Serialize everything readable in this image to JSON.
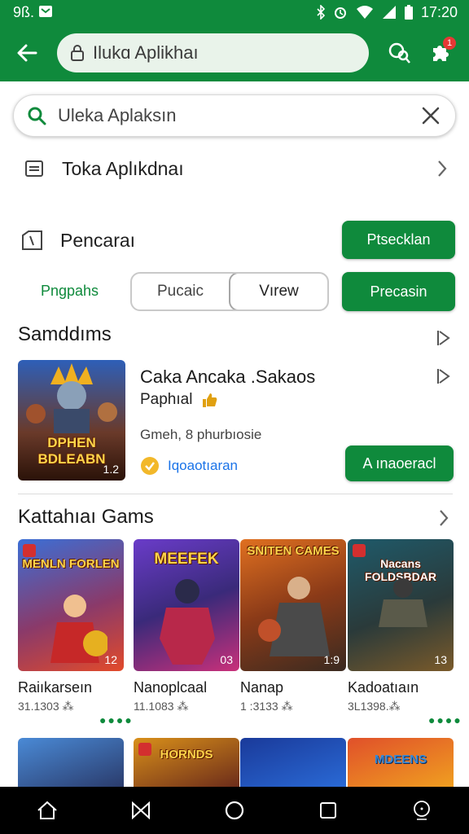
{
  "status_bar": {
    "time": "17:20",
    "left_text": "9ß."
  },
  "top_bar": {
    "url": "Ilukɑ Aplikhaı",
    "badge": "1"
  },
  "search": {
    "query": "Uleka Aplaksın"
  },
  "rows": {
    "apps_label": "Toka Aplıkdnaı",
    "search_label": "Pencaraı",
    "search_button": "Ptsecklan"
  },
  "filters": {
    "link": "Pngpahs",
    "options": [
      "Pucaic",
      "Vırew"
    ],
    "action": "Precasin"
  },
  "featured_section": {
    "title": "Samddıms",
    "game": {
      "title": "Caka Ancaka .Sakaos",
      "subtitle": "Paphıal",
      "meta": "Gmeh, 8 phurbıosie",
      "developer": "Iqoaotıaran",
      "art_text": "DPHEN BDLEABN",
      "art_corner": "1.2",
      "cta": "A ınaoeracl"
    }
  },
  "grid_section": {
    "title": "Kattahıaı Gams",
    "tiles": [
      {
        "name": "Raiıkarseın",
        "meta": "31.1303 ⁂",
        "art_text": "MENLN FORLEN",
        "corner": "12",
        "colors": [
          "#3b6fd6",
          "#e24a2a"
        ]
      },
      {
        "name": "Nanoplcaal",
        "meta": "11.1083 ⁂",
        "art_text": "MEEFEK",
        "corner": "03",
        "colors": [
          "#6a3cc9",
          "#c9307a"
        ]
      },
      {
        "name": "Nanap",
        "meta": "1 :3133 ⁂",
        "art_text": "SNITEN CAMES",
        "corner": "1:9",
        "colors": [
          "#c7551c",
          "#3a2a20"
        ]
      },
      {
        "name": "Kadoatıaın",
        "meta": "3L1398.⁂",
        "art_text": "Nacans FOLDSBDAR",
        "corner": "13",
        "colors": [
          "#1f5a6a",
          "#7a5a2a"
        ]
      }
    ],
    "second_row_labels": [
      "",
      "HORNDS",
      "",
      "MDEENS"
    ]
  },
  "colors": {
    "accent": "#0f8a3c",
    "link": "#1a73e8"
  }
}
